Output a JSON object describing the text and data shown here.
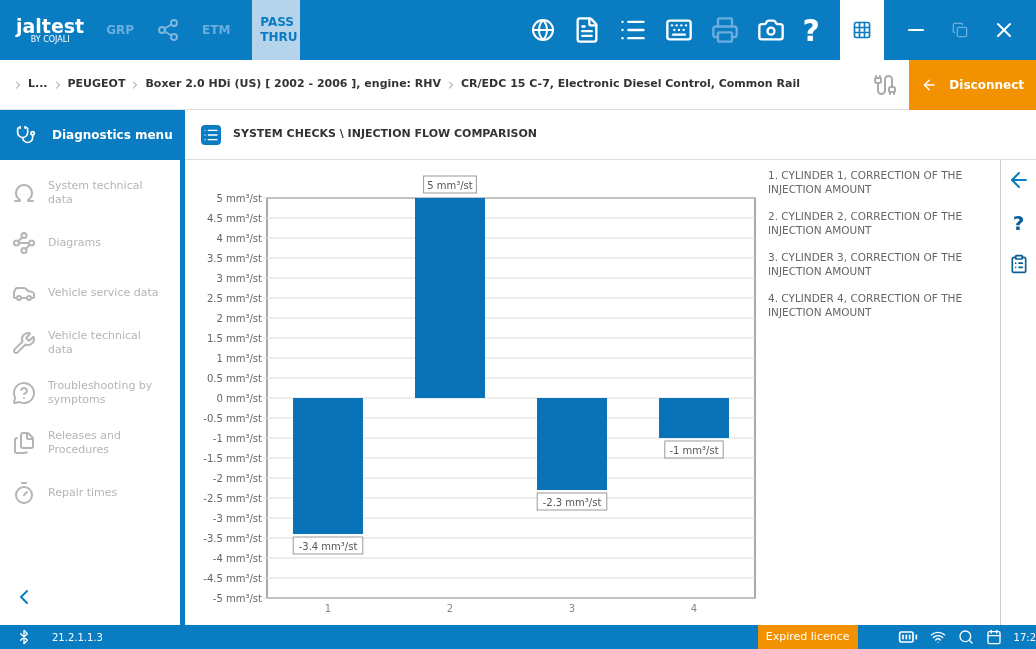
{
  "top_bar": {
    "logo": "jaltest",
    "logo_sub": "BY COJALI",
    "tabs": [
      {
        "label": "GRP",
        "selected": false
      },
      {
        "label": "ETM",
        "selected": false
      },
      {
        "label": "PASS THRU",
        "selected": true
      }
    ],
    "help": "?"
  },
  "breadcrumb": [
    "L...",
    "PEUGEOT",
    "Boxer 2.0 HDi (US) [ 2002 - 2006 ], engine: RHV",
    "CR/EDC 15 C-7, Electronic Diesel Control, Common Rail"
  ],
  "disconnect_button": "Disconnect",
  "sidebar": {
    "header": {
      "label": "Diagnostics menu",
      "selected": true
    },
    "items": [
      {
        "label": "System technical data",
        "kind": "omega",
        "disabled": true
      },
      {
        "label": "Diagrams",
        "kind": "diagram",
        "disabled": true
      },
      {
        "label": "Vehicle service data",
        "kind": "service",
        "disabled": true
      },
      {
        "label": "Vehicle technical data",
        "kind": "wrench",
        "disabled": true
      },
      {
        "label": "Troubleshooting by symptoms",
        "kind": "trouble",
        "disabled": true
      },
      {
        "label": "Releases and Procedures",
        "kind": "files",
        "disabled": true
      },
      {
        "label": "Repair times",
        "kind": "timer",
        "disabled": true
      }
    ]
  },
  "panel": {
    "title": "SYSTEM CHECKS \\ INJECTION FLOW COMPARISON",
    "chart_data": {
      "type": "bar",
      "grid": true,
      "categories": [
        "1",
        "2",
        "3",
        "4"
      ],
      "series": [
        {
          "color": "#0a73b8",
          "values": [
            -3.4,
            5,
            -2.3,
            -1
          ]
        }
      ],
      "ylim": [
        -5,
        5
      ],
      "yticks": [
        {
          "value": 5,
          "label": "5 mm³/st"
        },
        {
          "value": 4.5,
          "label": "4.5 mm³/st"
        },
        {
          "value": 4,
          "label": "4 mm³/st"
        },
        {
          "value": 3.5,
          "label": "3.5 mm³/st"
        },
        {
          "value": 3,
          "label": "3 mm³/st"
        },
        {
          "value": 2.5,
          "label": "2.5 mm³/st"
        },
        {
          "value": 2,
          "label": "2 mm³/st"
        },
        {
          "value": 1.5,
          "label": "1.5 mm³/st"
        },
        {
          "value": 1,
          "label": "1 mm³/st"
        },
        {
          "value": 0.5,
          "label": "0.5 mm³/st"
        },
        {
          "value": 0,
          "label": "0 mm³/st"
        },
        {
          "value": -0.5,
          "label": "-0.5 mm³/st"
        },
        {
          "value": -1,
          "label": "-1 mm³/st"
        },
        {
          "value": -1.5,
          "label": "-1.5 mm³/st"
        },
        {
          "value": -2,
          "label": "-2 mm³/st"
        },
        {
          "value": -2.5,
          "label": "-2.5 mm³/st"
        },
        {
          "value": -3,
          "label": "-3 mm³/st"
        },
        {
          "value": -3.5,
          "label": "-3.5 mm³/st"
        },
        {
          "value": -4,
          "label": "-4 mm³/st"
        },
        {
          "value": -4.5,
          "label": "-4.5 mm³/st"
        },
        {
          "value": -5,
          "label": "-5 mm³/st"
        }
      ],
      "value_labels": [
        "-3.4 mm³/st",
        "5 mm³/st",
        "-2.3 mm³/st",
        "-1 mm³/st"
      ]
    },
    "legend": [
      "1. CYLINDER 1, CORRECTION OF THE INJECTION AMOUNT",
      "2. CYLINDER 2, CORRECTION OF THE INJECTION AMOUNT",
      "3. CYLINDER 3, CORRECTION OF THE INJECTION AMOUNT",
      "4. CYLINDER 4, CORRECTION OF THE INJECTION AMOUNT"
    ]
  },
  "right_panel": {
    "help": "?"
  },
  "status_bar": {
    "version": "21.2.1.1.3",
    "licence": "Expired licence",
    "time": "17:2"
  }
}
